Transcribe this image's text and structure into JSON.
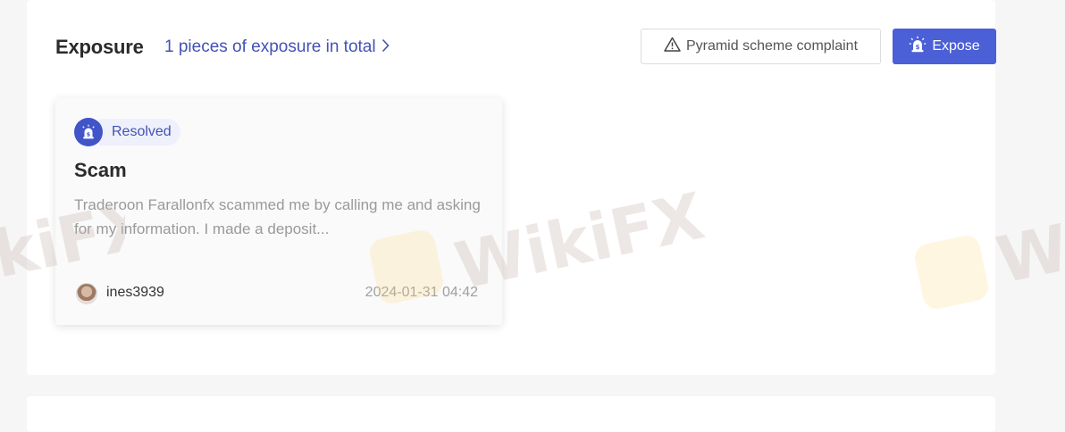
{
  "header": {
    "title": "Exposure",
    "count_link": "1 pieces of exposure in total",
    "complaint_button": "Pyramid scheme complaint",
    "expose_button": "Expose"
  },
  "card": {
    "status": "Resolved",
    "title": "Scam",
    "description": "Traderoon Farallonfx scammed me by calling me and asking for my information. I made a deposit...",
    "user": "ines3939",
    "date": "2024-01-31 04:42"
  },
  "watermark": {
    "text": "WikiFX",
    "text_left": "kiFX",
    "text_right": "Wi"
  },
  "colors": {
    "accent": "#4b5fd6",
    "link": "#4352b5",
    "badge_bg": "#eef0fb"
  },
  "icons": {
    "count_link": "chevron-right-icon",
    "complaint": "warning-triangle-icon",
    "expose": "alarm-light-icon",
    "status": "alarm-light-icon"
  }
}
